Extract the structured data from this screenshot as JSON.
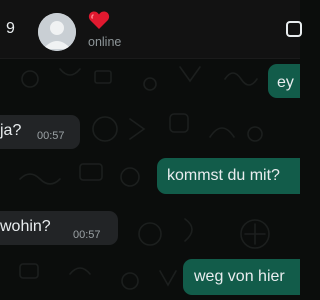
{
  "header": {
    "back_count": "9",
    "contact_name_emoji": "❤️",
    "status": "online"
  },
  "icons": {
    "avatar": "default-avatar-icon",
    "video_call": "video-call-icon"
  },
  "colors": {
    "outgoing_bubble": "#125c4a",
    "incoming_bubble": "#222426",
    "background": "#0b0d0c",
    "heart": "#e0192f"
  },
  "messages": [
    {
      "direction": "outgoing",
      "text": "ey",
      "time": ""
    },
    {
      "direction": "incoming",
      "text": "ja?",
      "time": "00:57"
    },
    {
      "direction": "outgoing",
      "text": "kommst du mit?",
      "time": ""
    },
    {
      "direction": "incoming",
      "text": "wohin?",
      "time": "00:57"
    },
    {
      "direction": "outgoing",
      "text": "weg von hier",
      "time": ""
    }
  ]
}
